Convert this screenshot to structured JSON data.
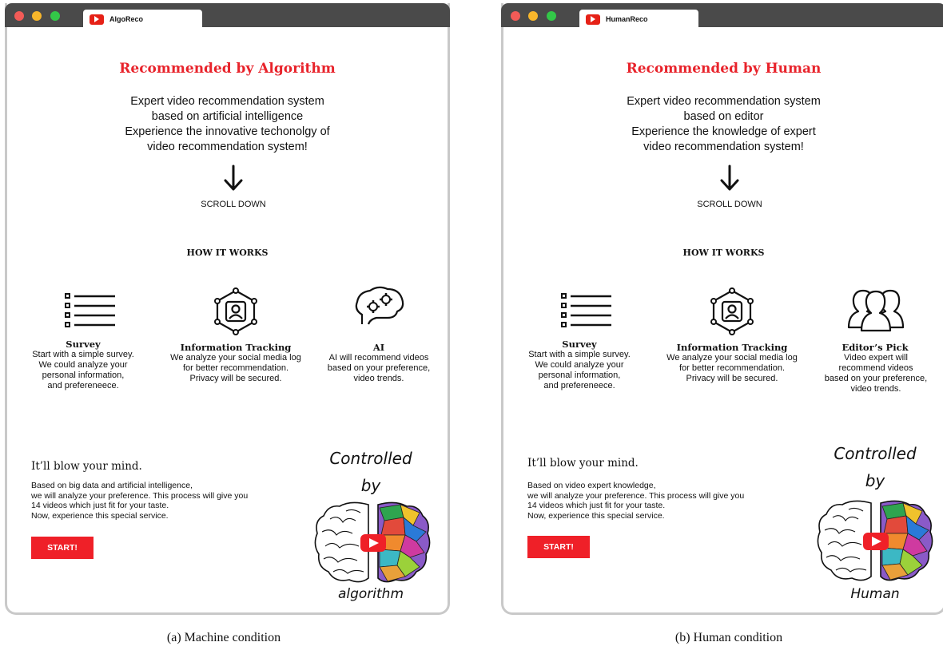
{
  "colors": {
    "accent": "#e8232b",
    "button": "#ef2028",
    "chrome": "#4a4a4a",
    "border": "#c9c9c9"
  },
  "panels": [
    {
      "tab_title": "AlgoReco",
      "headline": "Recommended by Algorithm",
      "intro": [
        "Expert video recommendation system",
        "based on artificial intelligence",
        "Experience the innovative techonolgy of",
        "video recommendation system!"
      ],
      "scroll_label": "SCROLL DOWN",
      "how_label": "HOW IT WORKS",
      "steps": [
        {
          "icon": "list-icon",
          "title": "Survey",
          "desc": [
            "Start with a simple survey.",
            "We could analyze your",
            "personal information,",
            "and prefereneece."
          ]
        },
        {
          "icon": "user-network-icon",
          "title": "Information Tracking",
          "desc": [
            "We analyze your social media log",
            "for better recommendation.",
            "Privacy will be secured."
          ]
        },
        {
          "icon": "brain-gears-icon",
          "title": "AI",
          "desc": [
            "AI will recommend videos",
            "based on your preference,",
            "video trends."
          ]
        }
      ],
      "tagline": "It’ll blow your mind.",
      "body": [
        "Based on big data and artificial intelligence,",
        "we will analyze your preference. This process will give you",
        "14 videos which just fit for your taste.",
        "Now, experience this special service."
      ],
      "start_label": "START!",
      "controlled": [
        "Controlled",
        "by",
        "algorithm"
      ]
    },
    {
      "tab_title": "HumanReco",
      "headline": "Recommended by Human",
      "intro": [
        "Expert video recommendation system",
        "based on editor",
        "Experience the knowledge of expert",
        "video recommendation system!"
      ],
      "scroll_label": "SCROLL DOWN",
      "how_label": "HOW IT WORKS",
      "steps": [
        {
          "icon": "list-icon",
          "title": "Survey",
          "desc": [
            "Start with a simple survey.",
            "We could analyze your",
            "personal information,",
            "and prefereneece."
          ]
        },
        {
          "icon": "user-network-icon",
          "title": "Information Tracking",
          "desc": [
            "We analyze your social media log",
            "for better recommendation.",
            "Privacy will be secured."
          ]
        },
        {
          "icon": "people-icon",
          "title": "Editor’s Pick",
          "desc": [
            "Video expert will",
            "recommend videos",
            "based on your preference,",
            "video trends."
          ]
        }
      ],
      "tagline": "It’ll blow your mind.",
      "body": [
        "Based on video expert knowledge,",
        "we will analyze your preference. This process will give you",
        "14 videos which just fit for your taste.",
        "Now, experience this special service."
      ],
      "start_label": "START!",
      "controlled": [
        "Controlled",
        "by",
        "Human"
      ]
    }
  ],
  "captions": [
    "(a) Machine condition",
    "(b) Human condition"
  ]
}
